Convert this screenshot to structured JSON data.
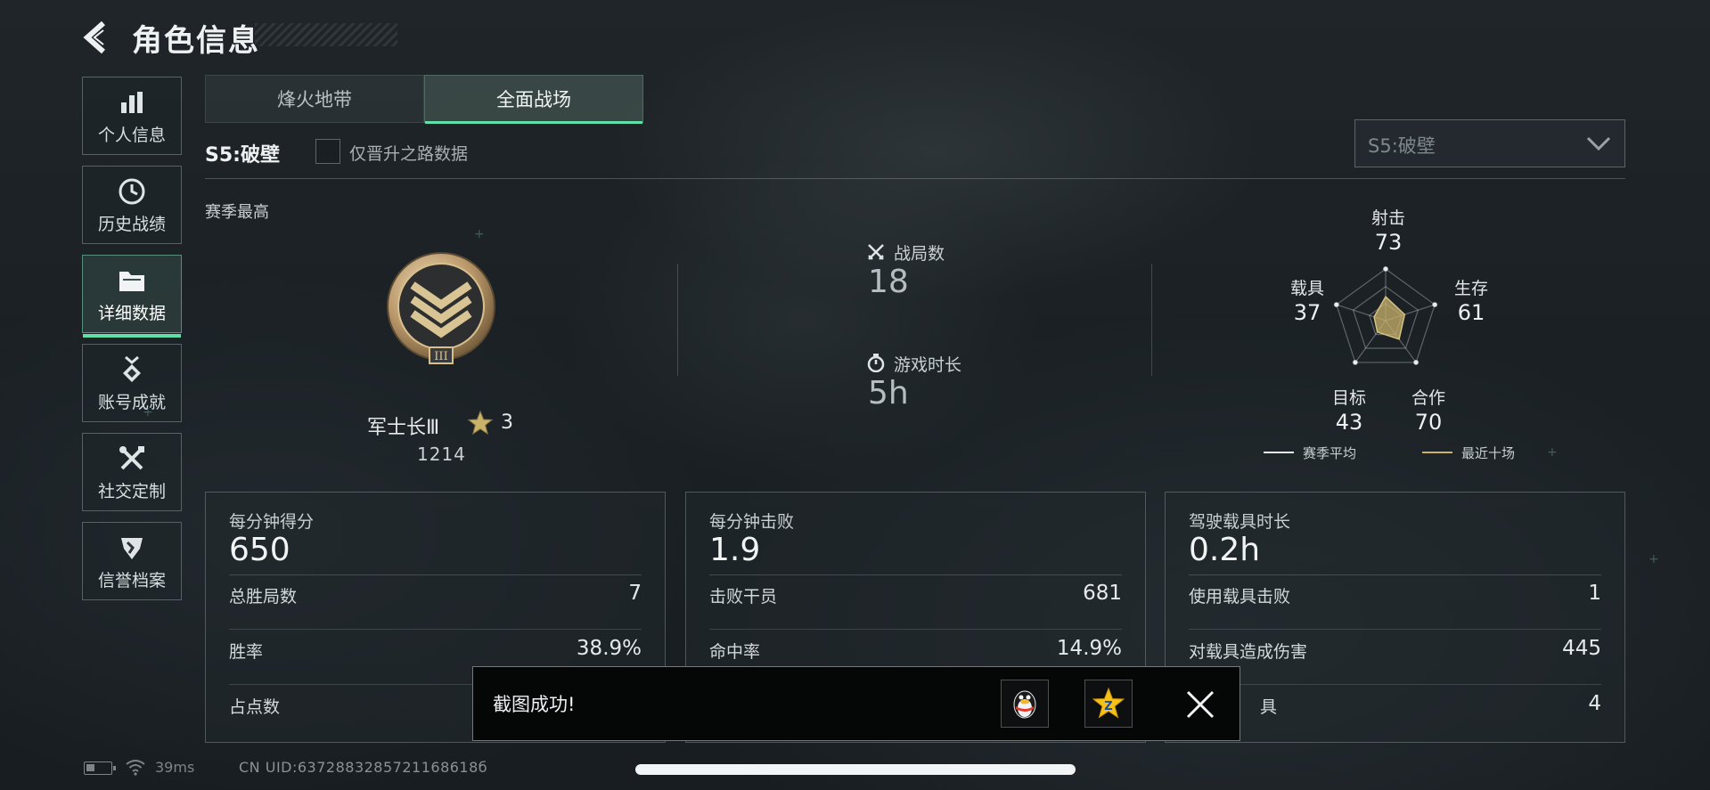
{
  "header": {
    "title": "角色信息"
  },
  "nav": [
    {
      "label": "个人信息",
      "icon": "bar-chart-icon"
    },
    {
      "label": "历史战绩",
      "icon": "clock-icon"
    },
    {
      "label": "详细数据",
      "icon": "folder-icon",
      "active": true
    },
    {
      "label": "账号成就",
      "icon": "medal-icon"
    },
    {
      "label": "社交定制",
      "icon": "tools-icon"
    },
    {
      "label": "信誉档案",
      "icon": "shield-icon"
    }
  ],
  "tabs": [
    {
      "label": "烽火地带"
    },
    {
      "label": "全面战场",
      "active": true
    }
  ],
  "season": {
    "name": "S5:破壁",
    "filter_label": "仅晋升之路数据",
    "filter_checked": false,
    "select_value": "S5:破壁",
    "best_label": "赛季最高"
  },
  "rank": {
    "name": "军士长Ⅲ",
    "stars": "3",
    "points": "1214"
  },
  "stats": {
    "battles_label": "战局数",
    "battles_value": "18",
    "playtime_label": "游戏时长",
    "playtime_value": "5h"
  },
  "radar": {
    "axes": [
      {
        "label": "射击",
        "value": "73"
      },
      {
        "label": "生存",
        "value": "61"
      },
      {
        "label": "合作",
        "value": "70"
      },
      {
        "label": "目标",
        "value": "43"
      },
      {
        "label": "载具",
        "value": "37"
      }
    ],
    "legend": [
      {
        "label": "赛季平均",
        "color": "#e8ecee"
      },
      {
        "label": "最近十场",
        "color": "#c9b26a"
      }
    ],
    "accent": "#c9b26a"
  },
  "cards": [
    {
      "title": "每分钟得分",
      "value": "650",
      "rows": [
        {
          "label": "总胜局数",
          "value": "7"
        },
        {
          "label": "胜率",
          "value": "38.9%"
        },
        {
          "label": "占点数",
          "value": ""
        }
      ]
    },
    {
      "title": "每分钟击败",
      "value": "1.9",
      "rows": [
        {
          "label": "击败干员",
          "value": "681"
        },
        {
          "label": "命中率",
          "value": "14.9%"
        },
        {
          "label": "",
          "value": ""
        }
      ]
    },
    {
      "title": "驾驶载具时长",
      "value": "0.2h",
      "rows": [
        {
          "label": "使用载具击败",
          "value": "1"
        },
        {
          "label": "对载具造成伤害",
          "value": "445"
        },
        {
          "label": "具",
          "value": "4"
        }
      ]
    }
  ],
  "toast": {
    "message": "截图成功!",
    "share1_icon": "penguin-icon",
    "share2_icon": "star-badge-icon"
  },
  "status": {
    "ping": "39ms",
    "uid": "CN UID:6372883285721168618б"
  }
}
